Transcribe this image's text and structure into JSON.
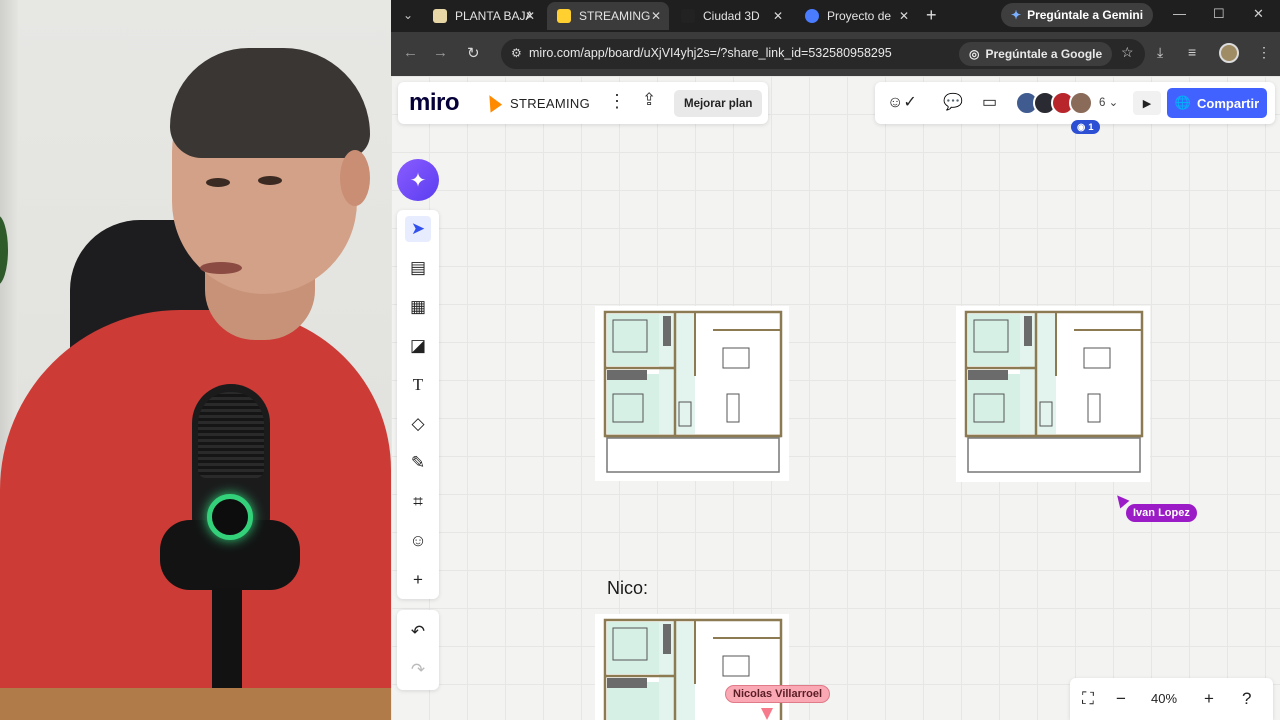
{
  "browser": {
    "tabs": [
      {
        "label": "PLANTA BAJA",
        "favicon_color": "#e8d7a6"
      },
      {
        "label": "STREAMING",
        "favicon_color": "#ffd02f"
      },
      {
        "label": "Ciudad 3D",
        "favicon_color": "#222222"
      },
      {
        "label": "Proyecto de",
        "favicon_color": "#4a7cff"
      }
    ],
    "gemini_label": "Pregúntale a Gemini",
    "url": "miro.com/app/board/uXjVI4yhj2s=/?share_link_id=532580958295",
    "ask_google_label": "Pregúntale a Google"
  },
  "miro": {
    "logo": "miro",
    "board_name": "STREAMING",
    "upgrade_label": "Mejorar plan",
    "collaborator_count": "6",
    "share_label": "Compartir",
    "viewer_count": "1",
    "zoom_level": "40%",
    "accent_color": "#4262ff",
    "tools": [
      "select-icon",
      "templates-icon",
      "frame-layout-icon",
      "sticky-note-icon",
      "text-icon",
      "shapes-icon",
      "pen-icon",
      "frame-icon",
      "emoji-icon",
      "add-icon"
    ]
  },
  "canvas": {
    "section_label": "Nico:",
    "cursors": [
      {
        "name": "Ivan Lopez",
        "color": "#9b1cc6",
        "text_color": "#ffffff"
      },
      {
        "name": "Nicolas Villarroel",
        "color": "#f9a8b4",
        "text_color": "#5a1d24"
      }
    ]
  }
}
